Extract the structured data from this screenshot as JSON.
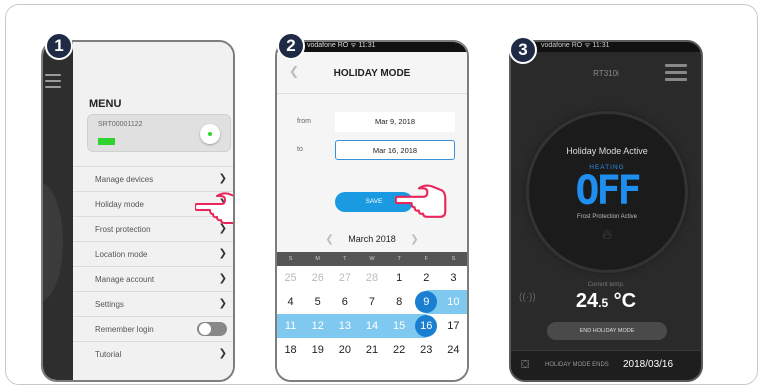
{
  "steps": [
    "1",
    "2",
    "3"
  ],
  "screen1": {
    "menu_title": "MENU",
    "device_id": "SRT00001122",
    "items": [
      "Manage devices",
      "Holiday mode",
      "Frost protection",
      "Location mode",
      "Manage account",
      "Settings",
      "Remember login",
      "Tutorial"
    ]
  },
  "screen2": {
    "status": "vodafone RO ᯤ  11:31",
    "title": "HOLIDAY MODE",
    "from_label": "from",
    "from_value": "Mar 9, 2018",
    "to_label": "to",
    "to_value": "Mar 16, 2018",
    "save_label": "SAVE",
    "calendar": {
      "month": "March 2018",
      "weekdays": [
        "S",
        "M",
        "T",
        "W",
        "T",
        "F",
        "S"
      ],
      "rows": [
        [
          "25",
          "26",
          "27",
          "28",
          "1",
          "2",
          "3"
        ],
        [
          "4",
          "5",
          "6",
          "7",
          "8",
          "9",
          "10"
        ],
        [
          "11",
          "12",
          "13",
          "14",
          "15",
          "16",
          "17"
        ],
        [
          "18",
          "19",
          "20",
          "21",
          "22",
          "23",
          "24"
        ]
      ]
    }
  },
  "screen3": {
    "status": "vodafone RO ᯤ  11:31",
    "model": "RT310i",
    "mode_title": "Holiday Mode Active",
    "heating_label": "HEATING",
    "state": "OFF",
    "frost_label": "Frost Protection Active",
    "current_label": "Current temp.",
    "temp_main": "24",
    "temp_dec": ".5",
    "temp_unit": " °C",
    "end_button": "END HOLIDAY MODE",
    "ends_label": "HOLIDAY MODE ENDS",
    "ends_date": "2018/03/16"
  },
  "colors": {
    "accent_blue": "#1a9ae0",
    "range_blue": "#7fc9f0",
    "green": "#2fd42f",
    "badge": "#1f2a44"
  }
}
